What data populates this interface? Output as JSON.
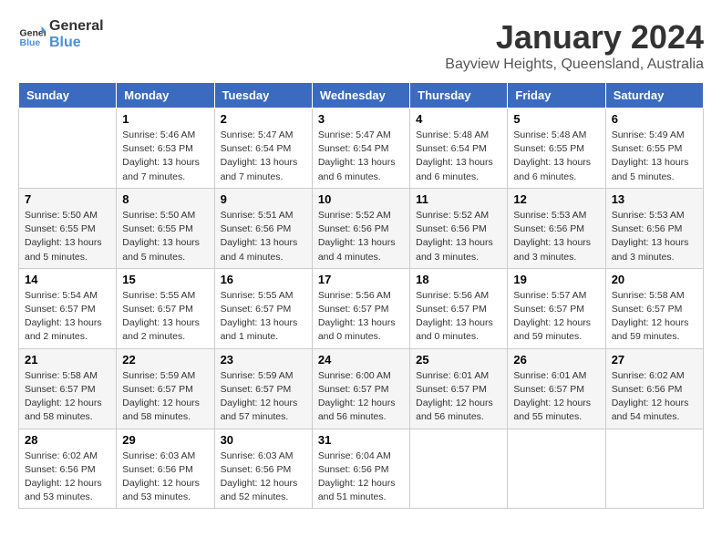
{
  "header": {
    "logo_general": "General",
    "logo_blue": "Blue",
    "month": "January 2024",
    "location": "Bayview Heights, Queensland, Australia"
  },
  "days_of_week": [
    "Sunday",
    "Monday",
    "Tuesday",
    "Wednesday",
    "Thursday",
    "Friday",
    "Saturday"
  ],
  "weeks": [
    [
      {
        "day": "",
        "sunrise": "",
        "sunset": "",
        "daylight": ""
      },
      {
        "day": "1",
        "sunrise": "Sunrise: 5:46 AM",
        "sunset": "Sunset: 6:53 PM",
        "daylight": "Daylight: 13 hours and 7 minutes."
      },
      {
        "day": "2",
        "sunrise": "Sunrise: 5:47 AM",
        "sunset": "Sunset: 6:54 PM",
        "daylight": "Daylight: 13 hours and 7 minutes."
      },
      {
        "day": "3",
        "sunrise": "Sunrise: 5:47 AM",
        "sunset": "Sunset: 6:54 PM",
        "daylight": "Daylight: 13 hours and 6 minutes."
      },
      {
        "day": "4",
        "sunrise": "Sunrise: 5:48 AM",
        "sunset": "Sunset: 6:54 PM",
        "daylight": "Daylight: 13 hours and 6 minutes."
      },
      {
        "day": "5",
        "sunrise": "Sunrise: 5:48 AM",
        "sunset": "Sunset: 6:55 PM",
        "daylight": "Daylight: 13 hours and 6 minutes."
      },
      {
        "day": "6",
        "sunrise": "Sunrise: 5:49 AM",
        "sunset": "Sunset: 6:55 PM",
        "daylight": "Daylight: 13 hours and 5 minutes."
      }
    ],
    [
      {
        "day": "7",
        "sunrise": "Sunrise: 5:50 AM",
        "sunset": "Sunset: 6:55 PM",
        "daylight": "Daylight: 13 hours and 5 minutes."
      },
      {
        "day": "8",
        "sunrise": "Sunrise: 5:50 AM",
        "sunset": "Sunset: 6:55 PM",
        "daylight": "Daylight: 13 hours and 5 minutes."
      },
      {
        "day": "9",
        "sunrise": "Sunrise: 5:51 AM",
        "sunset": "Sunset: 6:56 PM",
        "daylight": "Daylight: 13 hours and 4 minutes."
      },
      {
        "day": "10",
        "sunrise": "Sunrise: 5:52 AM",
        "sunset": "Sunset: 6:56 PM",
        "daylight": "Daylight: 13 hours and 4 minutes."
      },
      {
        "day": "11",
        "sunrise": "Sunrise: 5:52 AM",
        "sunset": "Sunset: 6:56 PM",
        "daylight": "Daylight: 13 hours and 3 minutes."
      },
      {
        "day": "12",
        "sunrise": "Sunrise: 5:53 AM",
        "sunset": "Sunset: 6:56 PM",
        "daylight": "Daylight: 13 hours and 3 minutes."
      },
      {
        "day": "13",
        "sunrise": "Sunrise: 5:53 AM",
        "sunset": "Sunset: 6:56 PM",
        "daylight": "Daylight: 13 hours and 3 minutes."
      }
    ],
    [
      {
        "day": "14",
        "sunrise": "Sunrise: 5:54 AM",
        "sunset": "Sunset: 6:57 PM",
        "daylight": "Daylight: 13 hours and 2 minutes."
      },
      {
        "day": "15",
        "sunrise": "Sunrise: 5:55 AM",
        "sunset": "Sunset: 6:57 PM",
        "daylight": "Daylight: 13 hours and 2 minutes."
      },
      {
        "day": "16",
        "sunrise": "Sunrise: 5:55 AM",
        "sunset": "Sunset: 6:57 PM",
        "daylight": "Daylight: 13 hours and 1 minute."
      },
      {
        "day": "17",
        "sunrise": "Sunrise: 5:56 AM",
        "sunset": "Sunset: 6:57 PM",
        "daylight": "Daylight: 13 hours and 0 minutes."
      },
      {
        "day": "18",
        "sunrise": "Sunrise: 5:56 AM",
        "sunset": "Sunset: 6:57 PM",
        "daylight": "Daylight: 13 hours and 0 minutes."
      },
      {
        "day": "19",
        "sunrise": "Sunrise: 5:57 AM",
        "sunset": "Sunset: 6:57 PM",
        "daylight": "Daylight: 12 hours and 59 minutes."
      },
      {
        "day": "20",
        "sunrise": "Sunrise: 5:58 AM",
        "sunset": "Sunset: 6:57 PM",
        "daylight": "Daylight: 12 hours and 59 minutes."
      }
    ],
    [
      {
        "day": "21",
        "sunrise": "Sunrise: 5:58 AM",
        "sunset": "Sunset: 6:57 PM",
        "daylight": "Daylight: 12 hours and 58 minutes."
      },
      {
        "day": "22",
        "sunrise": "Sunrise: 5:59 AM",
        "sunset": "Sunset: 6:57 PM",
        "daylight": "Daylight: 12 hours and 58 minutes."
      },
      {
        "day": "23",
        "sunrise": "Sunrise: 5:59 AM",
        "sunset": "Sunset: 6:57 PM",
        "daylight": "Daylight: 12 hours and 57 minutes."
      },
      {
        "day": "24",
        "sunrise": "Sunrise: 6:00 AM",
        "sunset": "Sunset: 6:57 PM",
        "daylight": "Daylight: 12 hours and 56 minutes."
      },
      {
        "day": "25",
        "sunrise": "Sunrise: 6:01 AM",
        "sunset": "Sunset: 6:57 PM",
        "daylight": "Daylight: 12 hours and 56 minutes."
      },
      {
        "day": "26",
        "sunrise": "Sunrise: 6:01 AM",
        "sunset": "Sunset: 6:57 PM",
        "daylight": "Daylight: 12 hours and 55 minutes."
      },
      {
        "day": "27",
        "sunrise": "Sunrise: 6:02 AM",
        "sunset": "Sunset: 6:56 PM",
        "daylight": "Daylight: 12 hours and 54 minutes."
      }
    ],
    [
      {
        "day": "28",
        "sunrise": "Sunrise: 6:02 AM",
        "sunset": "Sunset: 6:56 PM",
        "daylight": "Daylight: 12 hours and 53 minutes."
      },
      {
        "day": "29",
        "sunrise": "Sunrise: 6:03 AM",
        "sunset": "Sunset: 6:56 PM",
        "daylight": "Daylight: 12 hours and 53 minutes."
      },
      {
        "day": "30",
        "sunrise": "Sunrise: 6:03 AM",
        "sunset": "Sunset: 6:56 PM",
        "daylight": "Daylight: 12 hours and 52 minutes."
      },
      {
        "day": "31",
        "sunrise": "Sunrise: 6:04 AM",
        "sunset": "Sunset: 6:56 PM",
        "daylight": "Daylight: 12 hours and 51 minutes."
      },
      {
        "day": "",
        "sunrise": "",
        "sunset": "",
        "daylight": ""
      },
      {
        "day": "",
        "sunrise": "",
        "sunset": "",
        "daylight": ""
      },
      {
        "day": "",
        "sunrise": "",
        "sunset": "",
        "daylight": ""
      }
    ]
  ]
}
